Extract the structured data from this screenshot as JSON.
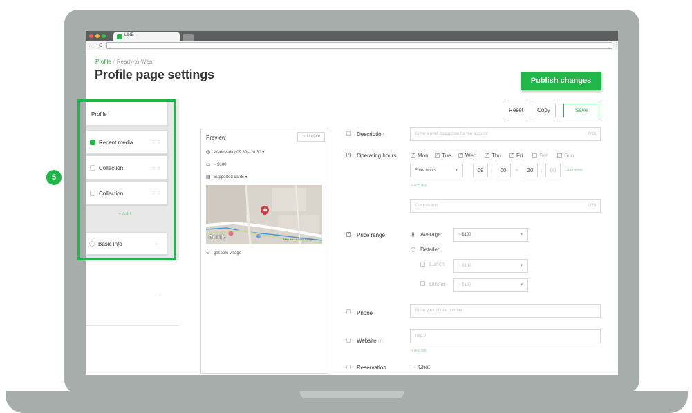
{
  "browser": {
    "tab_label": "LINE",
    "url": ""
  },
  "breadcrumb": {
    "root": "Profile",
    "current": "Ready-to-Wear"
  },
  "page_title": "Profile page settings",
  "publish_label": "Publish changes",
  "step_badge": "5",
  "sidebar": {
    "items": [
      {
        "label": "Profile"
      },
      {
        "label": "Recent media",
        "checked": true
      },
      {
        "label": "Collection",
        "checked": false
      },
      {
        "label": "Collection",
        "checked": false
      },
      {
        "label": "Basic info",
        "checked": false
      }
    ],
    "add_label": "+ Add"
  },
  "actions": {
    "reset": "Reset",
    "copy": "Copy",
    "save": "Save"
  },
  "preview": {
    "title": "Preview",
    "update": "Update",
    "hours": "Wednesday  09:30 - 20:30  ▾",
    "price": "~ $100",
    "cards": "Supported cards  ▾",
    "map_logo": "Google",
    "map_attribution": "Map data ©2020 Google",
    "location": "gasoom village"
  },
  "form": {
    "description": {
      "label": "Description",
      "placeholder": "Enter a brief description for the account",
      "count": "0/80"
    },
    "operating_hours": {
      "label": "Operating hours",
      "days": [
        {
          "label": "Mon",
          "checked": true
        },
        {
          "label": "Tue",
          "checked": true
        },
        {
          "label": "Wed",
          "checked": true
        },
        {
          "label": "Thu",
          "checked": true
        },
        {
          "label": "Fri",
          "checked": true
        },
        {
          "label": "Sat",
          "checked": false
        },
        {
          "label": "Sun",
          "checked": false
        }
      ],
      "hours_select": "Enter hours",
      "start_hour": "09",
      "start_min": "00",
      "dash": "~",
      "end_hour": "20",
      "end_min": "00",
      "add_hours": "+ Add hours",
      "add_day": "+ Add day",
      "custom_placeholder": "Custom text",
      "custom_count": "0/50"
    },
    "price_range": {
      "label": "Price range",
      "average_label": "Average",
      "average_value": "~ $100",
      "detailed_label": "Detailed",
      "lunch_label": "Lunch",
      "lunch_value": "~ $100",
      "dinner_label": "Dinner",
      "dinner_value": "~ $100"
    },
    "phone": {
      "label": "Phone",
      "placeholder": "Enter your phone number"
    },
    "website": {
      "label": "Website",
      "placeholder": "http://",
      "add_link": "+ Add link"
    },
    "reservation": {
      "label": "Reservation",
      "chat_label": "Chat"
    }
  },
  "colors": {
    "brand_green": "#1fb848",
    "laptop_body": "#a6adab"
  }
}
